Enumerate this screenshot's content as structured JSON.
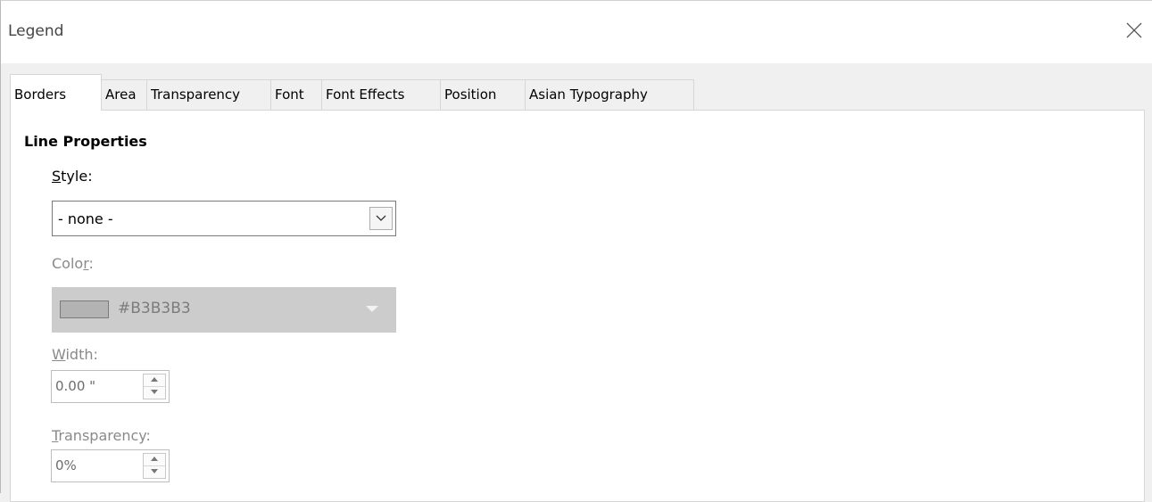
{
  "dialog": {
    "title": "Legend",
    "close_icon": "close-icon"
  },
  "tabs": [
    {
      "label": "Borders",
      "active": true
    },
    {
      "label": "Area"
    },
    {
      "label": "Transparency"
    },
    {
      "label": "Font"
    },
    {
      "label": "Font Effects"
    },
    {
      "label": "Position"
    },
    {
      "label": "Asian Typography"
    }
  ],
  "line_properties": {
    "section_title": "Line Properties",
    "style": {
      "label_mnemonic": "S",
      "label_rest": "tyle:",
      "value": "- none -"
    },
    "color": {
      "label_before": "Colo",
      "label_mnemonic": "r",
      "label_after": ":",
      "value": "#B3B3B3",
      "swatch_color": "#b3b3b3",
      "enabled": false
    },
    "width": {
      "label_mnemonic": "W",
      "label_rest": "idth:",
      "value": "0.00 \"",
      "enabled": false
    },
    "transparency": {
      "label_mnemonic": "T",
      "label_rest": "ransparency:",
      "value": "0%",
      "enabled": false
    }
  }
}
